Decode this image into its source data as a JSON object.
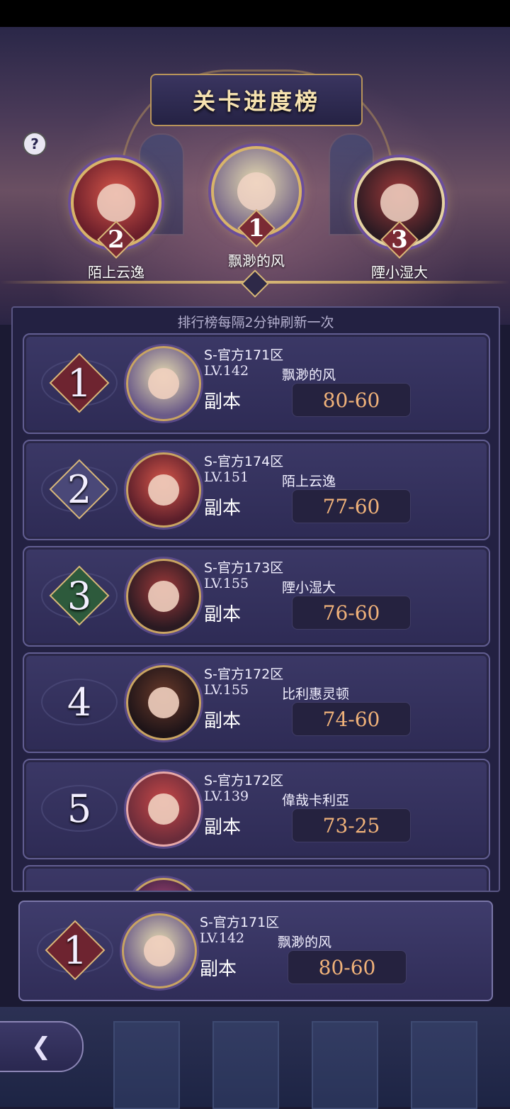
{
  "title": "关卡进度榜",
  "help_icon": "?",
  "podium": [
    {
      "rank": "2",
      "name": "陌上云逸"
    },
    {
      "rank": "1",
      "name": "飘渺的风"
    },
    {
      "rank": "3",
      "name": "陻小湿大"
    }
  ],
  "refresh_note": "排行榜每隔2分钟刷新一次",
  "rows": [
    {
      "rank": "1",
      "server": "S-官方171区",
      "level": "LV.142",
      "name": "飘渺的风",
      "mode": "副本",
      "progress": "80-60"
    },
    {
      "rank": "2",
      "server": "S-官方174区",
      "level": "LV.151",
      "name": "陌上云逸",
      "mode": "副本",
      "progress": "77-60"
    },
    {
      "rank": "3",
      "server": "S-官方173区",
      "level": "LV.155",
      "name": "陻小湿大",
      "mode": "副本",
      "progress": "76-60"
    },
    {
      "rank": "4",
      "server": "S-官方172区",
      "level": "LV.155",
      "name": "比利惠灵顿",
      "mode": "副本",
      "progress": "74-60"
    },
    {
      "rank": "5",
      "server": "S-官方172区",
      "level": "LV.139",
      "name": "偉哉卡利亞",
      "mode": "副本",
      "progress": "73-25"
    }
  ],
  "my_rank": {
    "rank": "1",
    "server": "S-官方171区",
    "level": "LV.142",
    "name": "飘渺的风",
    "mode": "副本",
    "progress": "80-60"
  },
  "back_icon": "❮"
}
